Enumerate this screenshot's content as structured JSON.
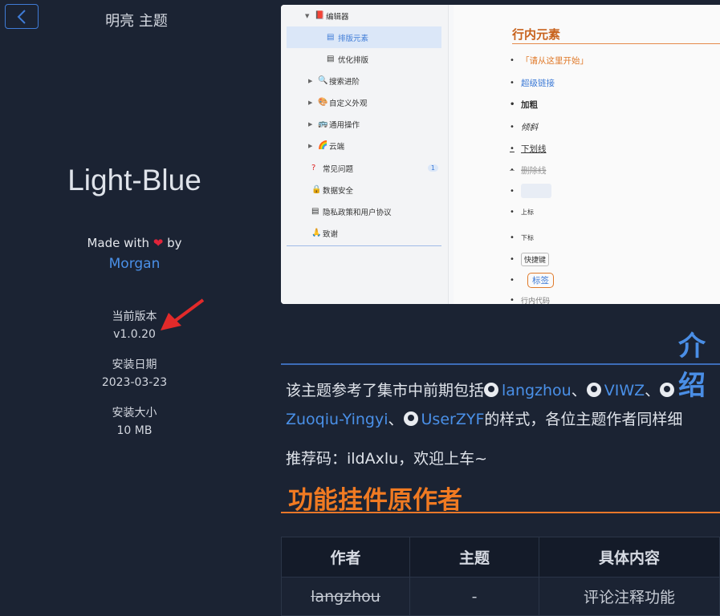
{
  "header": {
    "title": "明亮 主题"
  },
  "theme": {
    "name": "Light-Blue",
    "made_with_prefix": "Made with",
    "made_with_suffix": "by",
    "author": "Morgan"
  },
  "meta": {
    "version_label": "当前版本",
    "version_value": "v1.0.20",
    "install_date_label": "安装日期",
    "install_date_value": "2023-03-23",
    "install_size_label": "安装大小",
    "install_size_value": "10 MB"
  },
  "preview": {
    "sidebar": [
      {
        "label": "编辑器",
        "expandable": true,
        "icon": "editor-icon"
      },
      {
        "label": "排版元素",
        "selected": true,
        "icon": "doc-icon"
      },
      {
        "label": "优化排版",
        "icon": "doc-icon"
      },
      {
        "label": "搜索进阶",
        "expandable": true,
        "icon": "search-icon"
      },
      {
        "label": "自定义外观",
        "expandable": true,
        "icon": "palette-icon"
      },
      {
        "label": "通用操作",
        "expandable": true,
        "icon": "bus-icon"
      },
      {
        "label": "云端",
        "expandable": true,
        "icon": "rainbow-icon"
      },
      {
        "label": "常见问题",
        "icon": "question-icon",
        "badge": "1"
      },
      {
        "label": "数据安全",
        "icon": "lock-icon"
      },
      {
        "label": "隐私政策和用户协议",
        "icon": "doc-icon"
      },
      {
        "label": "致谢",
        "icon": "pray-icon"
      }
    ],
    "heading": "行内元素",
    "items": [
      "「请从这里开始」",
      "超级链接",
      "加粗",
      "倾斜",
      "下划线",
      "删除线",
      "",
      "上标",
      "下标",
      "快捷键",
      "标签",
      "行内代码"
    ]
  },
  "content": {
    "intro_title": "介绍",
    "para1_prefix": "该主题参考了集市中前期包括",
    "para1_link1": "langzhou",
    "sep": "、",
    "para1_link2": "VIWZ",
    "para2_link1": "Zuoqiu-Yingyi",
    "para2_link2": "UserZYF",
    "para2_suffix": "的样式，各位主题作者同样细",
    "para3": "推荐码：ildAxlu，欢迎上车~",
    "section_title": "功能挂件原作者"
  },
  "table": {
    "headers": [
      "作者",
      "主题",
      "具体内容"
    ],
    "rows": [
      [
        "langzhou",
        "-",
        "评论注释功能"
      ]
    ]
  }
}
